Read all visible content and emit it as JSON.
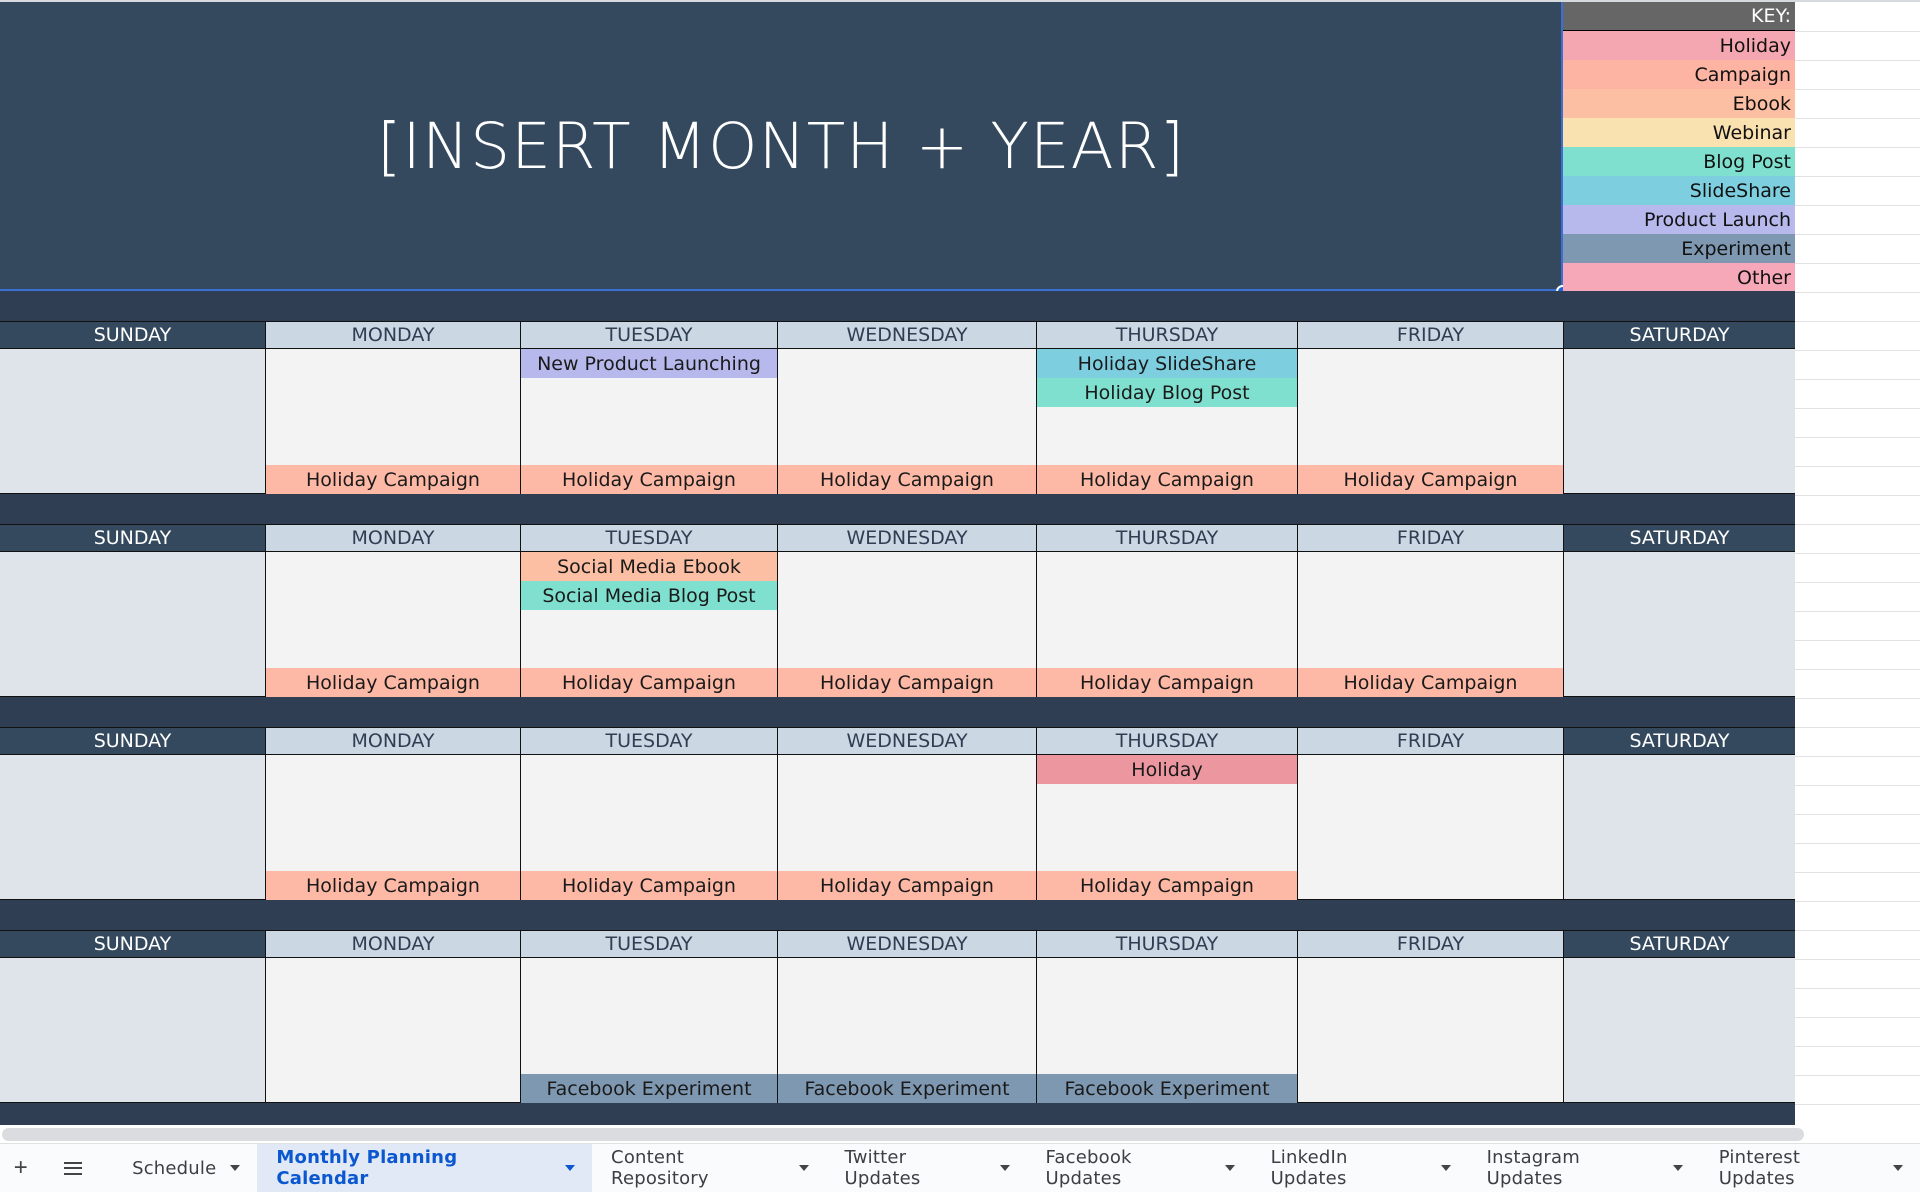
{
  "title": "[INSERT MONTH + YEAR]",
  "key": {
    "header": "KEY:",
    "items": [
      {
        "label": "Holiday",
        "color": "#f4a7b0"
      },
      {
        "label": "Campaign",
        "color": "#fdb4a2"
      },
      {
        "label": "Ebook",
        "color": "#fdbfa3"
      },
      {
        "label": "Webinar",
        "color": "#f9e1b0"
      },
      {
        "label": "Blog Post",
        "color": "#7fe0cf"
      },
      {
        "label": "SlideShare",
        "color": "#7dcfe0"
      },
      {
        "label": "Product Launch",
        "color": "#b7b9ec"
      },
      {
        "label": "Experiment",
        "color": "#7f98b2"
      },
      {
        "label": "Other",
        "color": "#f7a8b8"
      }
    ]
  },
  "days": [
    "SUNDAY",
    "MONDAY",
    "TUESDAY",
    "WEDNESDAY",
    "THURSDAY",
    "FRIDAY",
    "SATURDAY"
  ],
  "weeks": [
    {
      "cells": [
        {
          "top": [],
          "bottom": null
        },
        {
          "top": [],
          "bottom": {
            "label": "Holiday Campaign",
            "type": "Campaign"
          }
        },
        {
          "top": [
            {
              "label": "New Product Launching",
              "type": "Product Launch"
            }
          ],
          "bottom": {
            "label": "Holiday Campaign",
            "type": "Campaign"
          }
        },
        {
          "top": [],
          "bottom": {
            "label": "Holiday Campaign",
            "type": "Campaign"
          }
        },
        {
          "top": [
            {
              "label": "Holiday SlideShare",
              "type": "SlideShare"
            },
            {
              "label": "Holiday Blog Post",
              "type": "Blog Post"
            }
          ],
          "bottom": {
            "label": "Holiday Campaign",
            "type": "Campaign"
          }
        },
        {
          "top": [],
          "bottom": {
            "label": "Holiday Campaign",
            "type": "Campaign"
          }
        },
        {
          "top": [],
          "bottom": null
        }
      ]
    },
    {
      "cells": [
        {
          "top": [],
          "bottom": null
        },
        {
          "top": [],
          "bottom": {
            "label": "Holiday Campaign",
            "type": "Campaign"
          }
        },
        {
          "top": [
            {
              "label": "Social Media Ebook",
              "type": "Ebook"
            },
            {
              "label": "Social Media Blog Post",
              "type": "Blog Post"
            }
          ],
          "bottom": {
            "label": "Holiday Campaign",
            "type": "Campaign"
          }
        },
        {
          "top": [],
          "bottom": {
            "label": "Holiday Campaign",
            "type": "Campaign"
          }
        },
        {
          "top": [],
          "bottom": {
            "label": "Holiday Campaign",
            "type": "Campaign"
          }
        },
        {
          "top": [],
          "bottom": {
            "label": "Holiday Campaign",
            "type": "Campaign"
          }
        },
        {
          "top": [],
          "bottom": null
        }
      ]
    },
    {
      "cells": [
        {
          "top": [],
          "bottom": null
        },
        {
          "top": [],
          "bottom": {
            "label": "Holiday Campaign",
            "type": "Campaign"
          }
        },
        {
          "top": [],
          "bottom": {
            "label": "Holiday Campaign",
            "type": "Campaign"
          }
        },
        {
          "top": [],
          "bottom": {
            "label": "Holiday Campaign",
            "type": "Campaign"
          }
        },
        {
          "top": [
            {
              "label": "Holiday",
              "type": "Holiday-event"
            }
          ],
          "bottom": {
            "label": "Holiday Campaign",
            "type": "Campaign"
          }
        },
        {
          "top": [],
          "bottom": null
        },
        {
          "top": [],
          "bottom": null
        }
      ]
    },
    {
      "cells": [
        {
          "top": [],
          "bottom": null
        },
        {
          "top": [],
          "bottom": null
        },
        {
          "top": [],
          "bottom": {
            "label": "Facebook Experiment",
            "type": "Experiment"
          }
        },
        {
          "top": [],
          "bottom": {
            "label": "Facebook Experiment",
            "type": "Experiment"
          }
        },
        {
          "top": [],
          "bottom": {
            "label": "Facebook Experiment",
            "type": "Experiment"
          }
        },
        {
          "top": [],
          "bottom": null
        },
        {
          "top": [],
          "bottom": null
        }
      ]
    }
  ],
  "event_colors": {
    "Campaign": "#fdb9a6",
    "Product Launch": "#b7b9ec",
    "SlideShare": "#7dcfe0",
    "Blog Post": "#7fe0cf",
    "Ebook": "#fdbfa3",
    "Holiday-event": "#ec969f",
    "Experiment": "#7f98b2"
  },
  "sheet_tabs": {
    "add_label": "+",
    "tabs": [
      {
        "label": "Schedule",
        "active": false
      },
      {
        "label": "Monthly Planning Calendar",
        "active": true
      },
      {
        "label": "Content Repository",
        "active": false
      },
      {
        "label": "Twitter Updates",
        "active": false
      },
      {
        "label": "Facebook Updates",
        "active": false
      },
      {
        "label": "LinkedIn Updates",
        "active": false
      },
      {
        "label": "Instagram Updates",
        "active": false
      },
      {
        "label": "Pinterest Updates",
        "active": false
      }
    ]
  }
}
